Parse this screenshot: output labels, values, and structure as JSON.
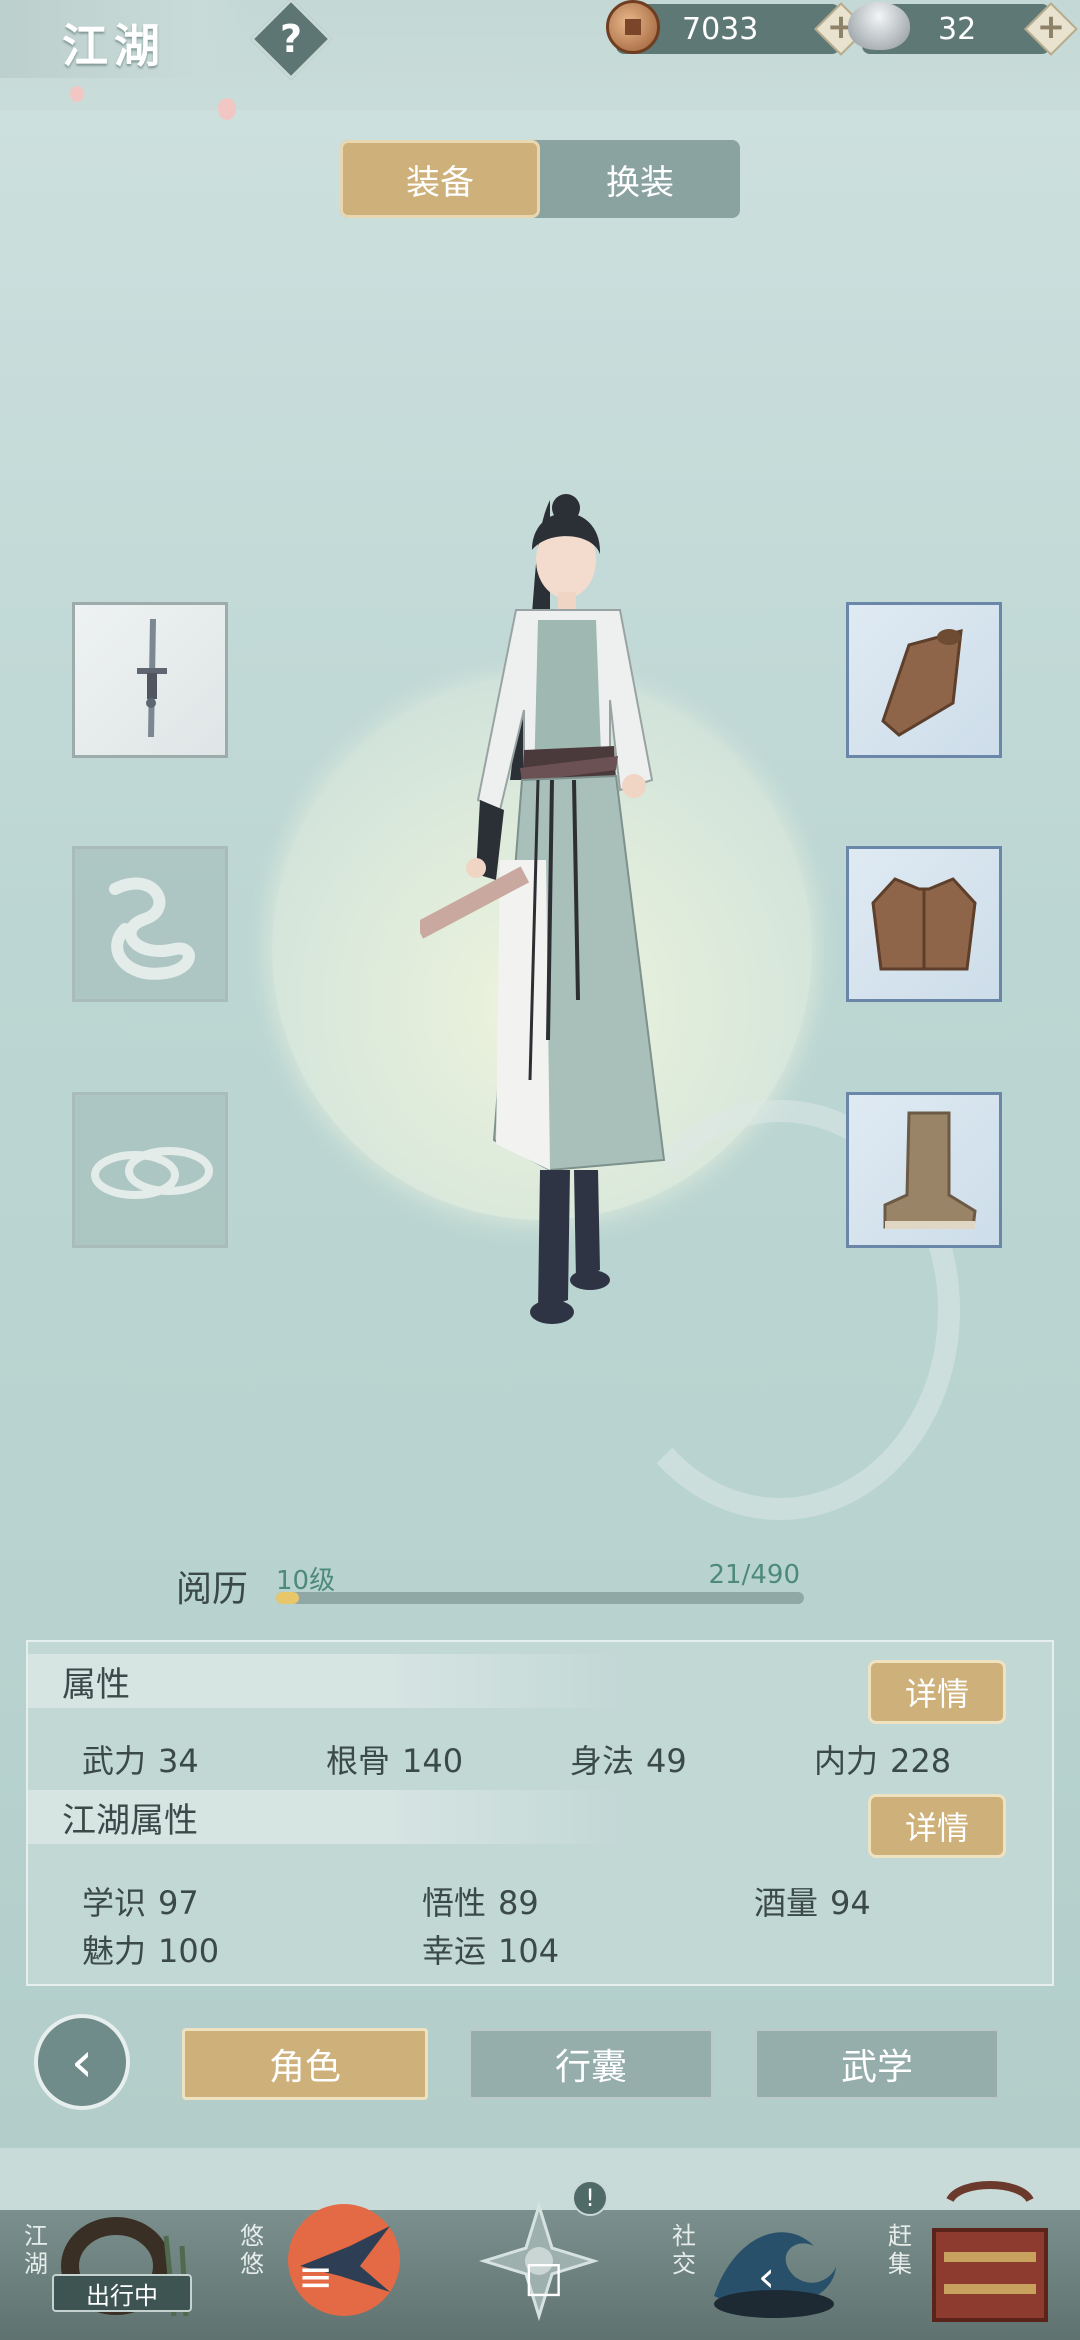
{
  "header": {
    "title": "江湖",
    "help_symbol": "?",
    "coins": "7033",
    "silver": "32",
    "plus_symbol": "+"
  },
  "tabs": [
    {
      "label": "装备",
      "active": true
    },
    {
      "label": "换装",
      "active": false
    }
  ],
  "equipment": {
    "left": [
      "sword-icon",
      "empty-pendant-slot",
      "empty-ring-slot"
    ],
    "right": [
      "bracer-icon",
      "vest-icon",
      "boot-icon"
    ]
  },
  "experience": {
    "label": "阅历",
    "level": "10级",
    "count": "21/490",
    "progress": 0.043
  },
  "attributes": {
    "title": "属性",
    "detail_label": "详情",
    "items": [
      {
        "name": "武力",
        "value": "34"
      },
      {
        "name": "根骨",
        "value": "140"
      },
      {
        "name": "身法",
        "value": "49"
      },
      {
        "name": "内力",
        "value": "228"
      }
    ]
  },
  "jianghu_attributes": {
    "title": "江湖属性",
    "detail_label": "详情",
    "items": [
      {
        "name": "学识",
        "value": "97"
      },
      {
        "name": "悟性",
        "value": "89"
      },
      {
        "name": "酒量",
        "value": "94"
      },
      {
        "name": "魅力",
        "value": "100"
      },
      {
        "name": "幸运",
        "value": "104"
      }
    ]
  },
  "bottom_nav": {
    "back_symbol": "‹",
    "buttons": [
      {
        "label": "角色",
        "active": true
      },
      {
        "label": "行囊",
        "active": false
      },
      {
        "label": "武学",
        "active": false
      }
    ]
  },
  "dock": {
    "items": [
      {
        "label": "江湖",
        "badge": "出行中"
      },
      {
        "label": "悠悠"
      },
      {
        "label": ""
      },
      {
        "label": "社交"
      },
      {
        "label": "赶集"
      }
    ],
    "notice_symbol": "!",
    "system_keys": [
      "≡",
      "□",
      "‹"
    ]
  },
  "colors": {
    "gold_button": "#cdb07a",
    "teal_bg": "#bcd6d3",
    "slate": "#5e7875"
  }
}
